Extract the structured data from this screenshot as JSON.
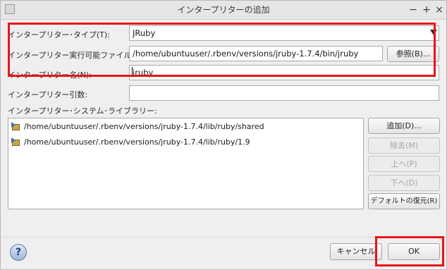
{
  "window": {
    "title": "インタープリターの追加",
    "minimize_label": "−",
    "maximize_label": "+",
    "close_label": "×"
  },
  "form": {
    "type_label": "インタープリター･タイプ(T):",
    "type_value": "JRuby",
    "executable_label": "インタープリター実行可能ファイル(I):",
    "executable_value": "/home/ubuntuuser/.rbenv/versions/jruby-1.7.4/bin/jruby",
    "browse_label": "参照(B)...",
    "name_label": "インタープリター名(N):",
    "name_value": "jruby",
    "args_label": "インタープリター引数:",
    "args_value": ""
  },
  "library": {
    "label": "インタープリター･システム･ライブラリー:",
    "items": [
      "/home/ubuntuuser/.rbenv/versions/jruby-1.7.4/lib/ruby/shared",
      "/home/ubuntuuser/.rbenv/versions/jruby-1.7.4/lib/ruby/1.9"
    ],
    "buttons": {
      "add": "追加(D)...",
      "remove": "除去(M)",
      "up": "上へ(P)",
      "down": "下へ(D)",
      "restore_default": "デフォルトの復元(R)"
    }
  },
  "footer": {
    "help_label": "?",
    "cancel_label": "キャンセル",
    "ok_label": "OK"
  },
  "colors": {
    "highlight_box": "#e8141b"
  }
}
